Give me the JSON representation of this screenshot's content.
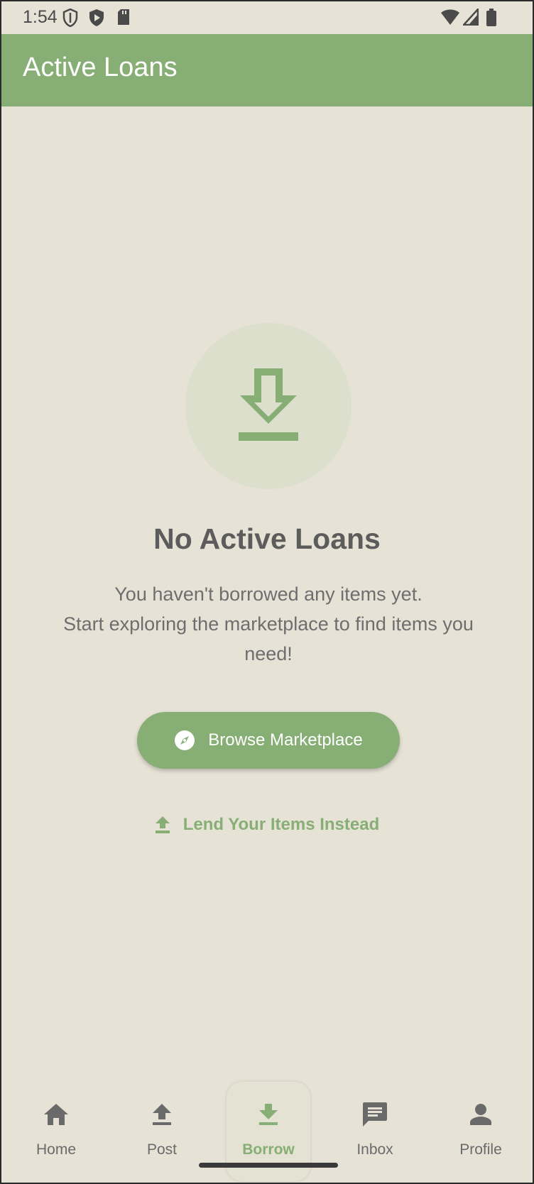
{
  "status_bar": {
    "time": "1:54",
    "icons": [
      "shield-icon",
      "play-store-icon",
      "sd-card-icon",
      "wifi-icon",
      "signal-icon",
      "battery-icon"
    ]
  },
  "app_bar": {
    "title": "Active Loans"
  },
  "empty_state": {
    "icon": "download-icon",
    "title": "No Active Loans",
    "description": "You haven't borrowed any items yet.\nStart exploring the marketplace to find items you need!",
    "primary_button": {
      "label": "Browse Marketplace",
      "icon": "compass-icon"
    },
    "secondary_link": {
      "label": "Lend Your Items Instead",
      "icon": "upload-icon"
    }
  },
  "bottom_nav": {
    "items": [
      {
        "label": "Home",
        "icon": "home-icon",
        "active": false
      },
      {
        "label": "Post",
        "icon": "upload-icon",
        "active": false
      },
      {
        "label": "Borrow",
        "icon": "download-icon",
        "active": true
      },
      {
        "label": "Inbox",
        "icon": "chat-icon",
        "active": false
      },
      {
        "label": "Profile",
        "icon": "person-icon",
        "active": false
      }
    ]
  },
  "colors": {
    "background": "#e6e2d6",
    "primary": "#87ae74",
    "circle": "#dcdfcc",
    "text_dark": "#5c5c5c",
    "text_muted": "#6e6e6e"
  }
}
